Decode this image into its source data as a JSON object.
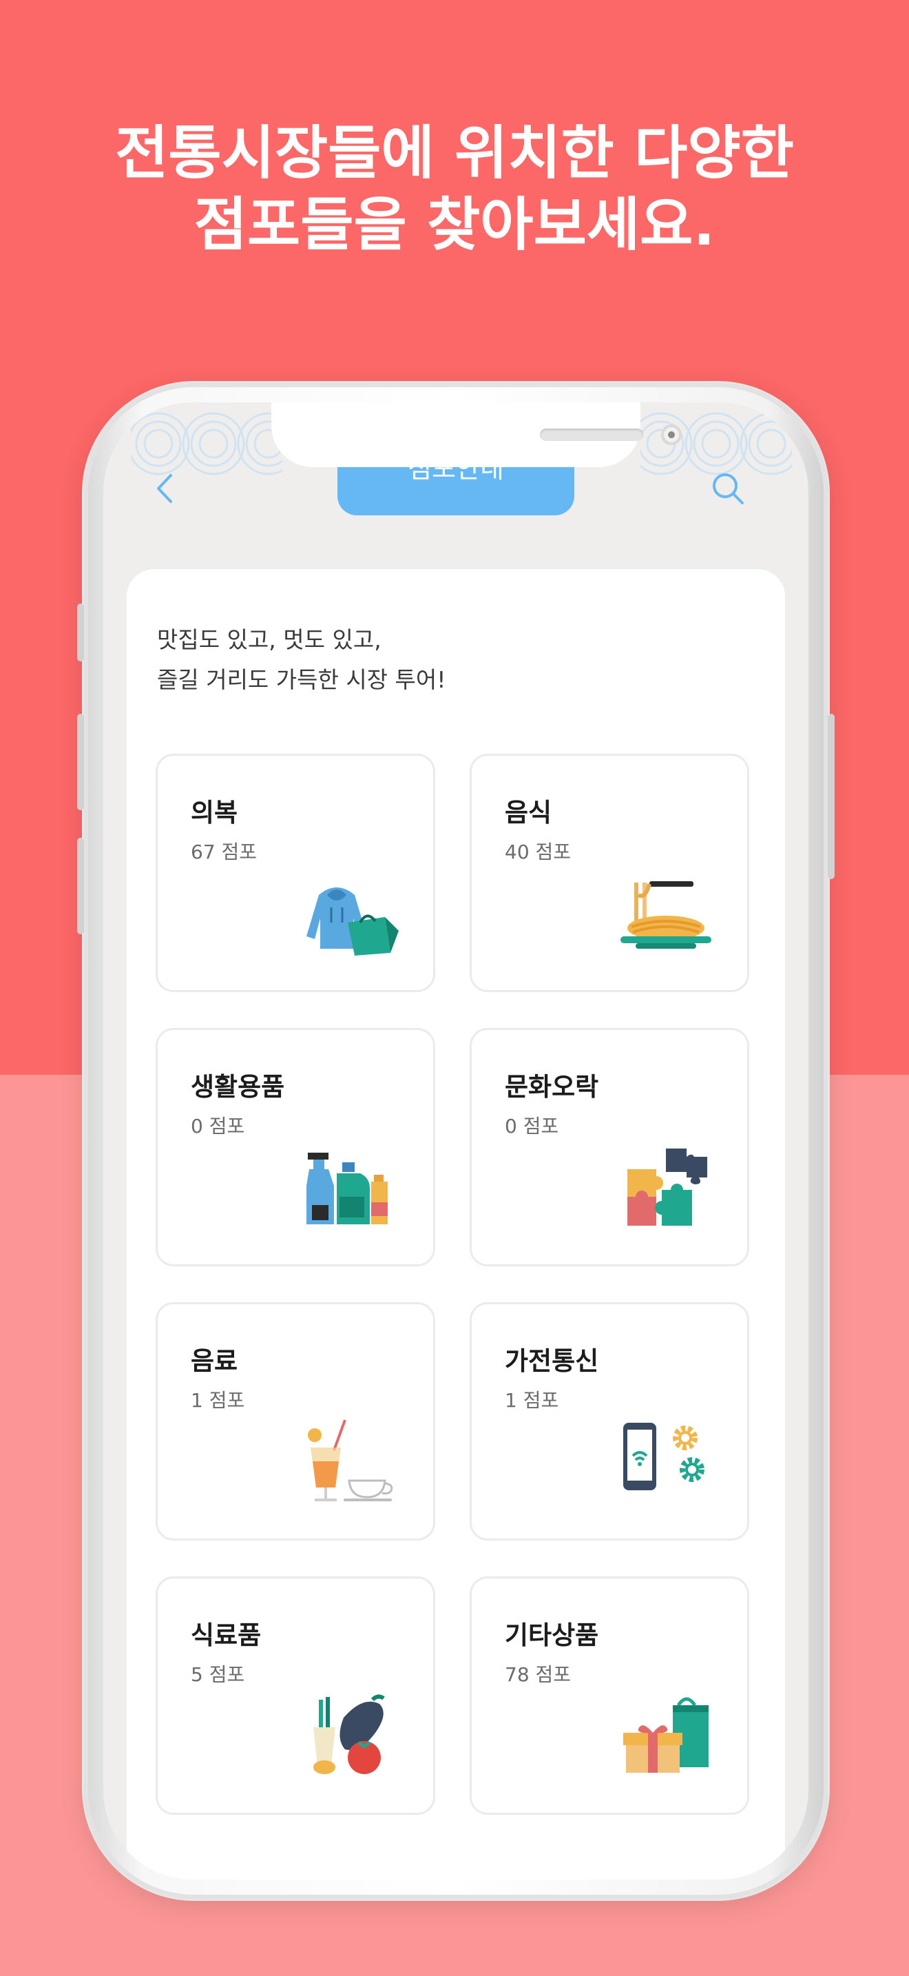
{
  "headline": {
    "line1": "전통시장들에 위치한 다양한",
    "line2": "점포들을 찾아보세요."
  },
  "screen": {
    "title": "점포안내",
    "intro_line1": "맛집도 있고, 멋도 있고,",
    "intro_line2": "즐길 거리도 가득한 시장 투어!"
  },
  "categories": [
    {
      "name": "의복",
      "count": "67 점포",
      "icon": "hoodie-shopping-bag-icon"
    },
    {
      "name": "음식",
      "count": "40 점포",
      "icon": "noodle-dish-icon"
    },
    {
      "name": "생활용품",
      "count": "0 점포",
      "icon": "cleaning-supplies-icon"
    },
    {
      "name": "문화오락",
      "count": "0 점포",
      "icon": "puzzle-pieces-icon"
    },
    {
      "name": "음료",
      "count": "1 점포",
      "icon": "juice-and-cup-icon"
    },
    {
      "name": "가전통신",
      "count": "1 점포",
      "icon": "phone-gears-icon"
    },
    {
      "name": "식료품",
      "count": "5 점포",
      "icon": "vegetables-icon"
    },
    {
      "name": "기타상품",
      "count": "78 점포",
      "icon": "gift-box-icon"
    }
  ],
  "colors": {
    "brand_red": "#fc6767",
    "soft_red": "#fc9696",
    "tab_blue": "#66b8f5"
  }
}
